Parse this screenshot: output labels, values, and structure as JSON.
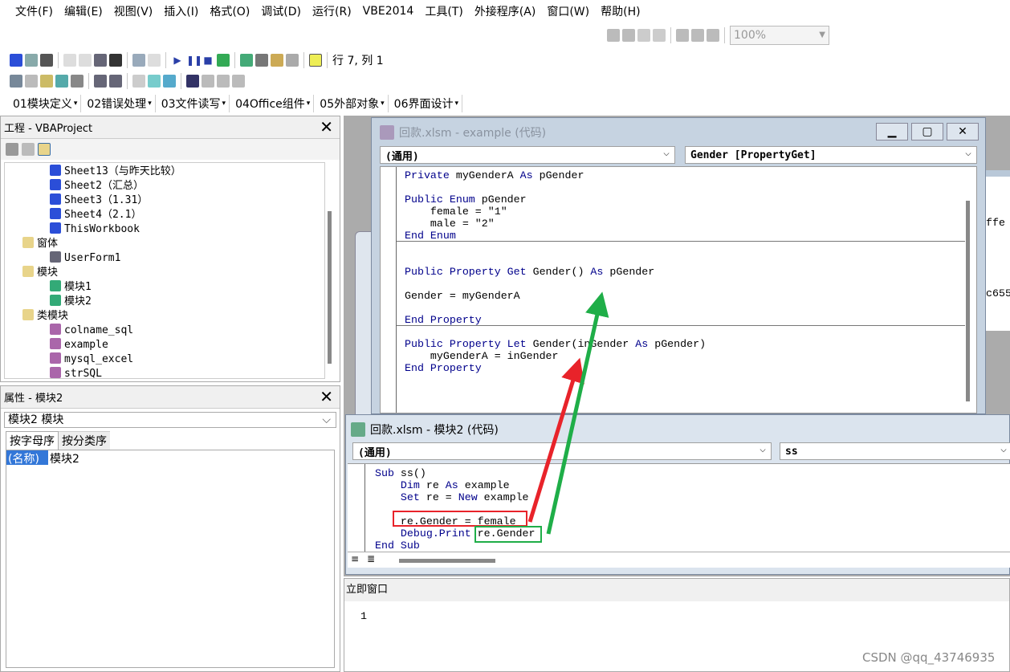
{
  "menu": [
    "文件(F)",
    "编辑(E)",
    "视图(V)",
    "插入(I)",
    "格式(O)",
    "调试(D)",
    "运行(R)",
    "VBE2014",
    "工具(T)",
    "外接程序(A)",
    "窗口(W)",
    "帮助(H)"
  ],
  "toolbar": {
    "zoom": "100%",
    "position": "行 7, 列 1",
    "addins": [
      "01模块定义",
      "02错误处理",
      "03文件读写",
      "04Office组件",
      "05外部对象",
      "06界面设计"
    ]
  },
  "project": {
    "title": "工程 - VBAProject",
    "items": [
      {
        "label": "Sheet13（与昨天比较）",
        "level": 2,
        "icon": "sheet-icon"
      },
      {
        "label": "Sheet2（汇总）",
        "level": 2,
        "icon": "sheet-icon"
      },
      {
        "label": "Sheet3（1.31）",
        "level": 2,
        "icon": "sheet-icon"
      },
      {
        "label": "Sheet4（2.1）",
        "level": 2,
        "icon": "sheet-icon"
      },
      {
        "label": "ThisWorkbook",
        "level": 2,
        "icon": "sheet-icon"
      },
      {
        "label": "窗体",
        "level": 1,
        "icon": "folder-icon"
      },
      {
        "label": "UserForm1",
        "level": 2,
        "icon": "form-icon"
      },
      {
        "label": "模块",
        "level": 1,
        "icon": "folder-icon"
      },
      {
        "label": "模块1",
        "level": 2,
        "icon": "module-icon"
      },
      {
        "label": "模块2",
        "level": 2,
        "icon": "module-icon"
      },
      {
        "label": "类模块",
        "level": 1,
        "icon": "folder-icon"
      },
      {
        "label": "colname_sql",
        "level": 2,
        "icon": "class-icon"
      },
      {
        "label": "example",
        "level": 2,
        "icon": "class-icon"
      },
      {
        "label": "mysql_excel",
        "level": 2,
        "icon": "class-icon"
      },
      {
        "label": "strSQL",
        "level": 2,
        "icon": "class-icon"
      }
    ]
  },
  "properties": {
    "title": "属性 - 模块2",
    "object": "模块2 模块",
    "tabs": [
      "按字母序",
      "按分类序"
    ],
    "row": {
      "name": "(名称)",
      "value": "模块2"
    }
  },
  "example_window": {
    "title": "回款.xlsm - example (代码)",
    "object": "(通用)",
    "procedure": "Gender [PropertyGet]",
    "lines": [
      [
        [
          "kw",
          "Private "
        ],
        [
          "",
          "myGenderA "
        ],
        [
          "kw",
          "As "
        ],
        [
          "",
          "pGender"
        ]
      ],
      [],
      [
        [
          "kw",
          "Public Enum "
        ],
        [
          "",
          "pGender"
        ]
      ],
      [
        [
          "",
          "    female = \"1\""
        ]
      ],
      [
        [
          "",
          "    male = \"2\""
        ]
      ],
      [
        [
          "kw",
          "End Enum"
        ]
      ],
      [],
      [],
      [
        [
          "kw",
          "Public Property Get "
        ],
        [
          "",
          "Gender() "
        ],
        [
          "kw",
          "As "
        ],
        [
          "",
          "pGender"
        ]
      ],
      [],
      [
        [
          "",
          "Gender = myGenderA"
        ]
      ],
      [],
      [
        [
          "kw",
          "End Property"
        ]
      ],
      [],
      [
        [
          "kw",
          "Public Property Let "
        ],
        [
          "",
          "Gender(inGender "
        ],
        [
          "kw",
          "As "
        ],
        [
          "",
          "pGender)"
        ]
      ],
      [
        [
          "",
          "    myGenderA = inGender"
        ]
      ],
      [
        [
          "kw",
          "End Property"
        ]
      ]
    ]
  },
  "module_window": {
    "title": "回款.xlsm - 模块2 (代码)",
    "object": "(通用)",
    "procedure": "ss",
    "lines": [
      [
        [
          "kw",
          "Sub "
        ],
        [
          "",
          "ss()"
        ]
      ],
      [
        [
          "kw",
          "    Dim "
        ],
        [
          "",
          "re "
        ],
        [
          "kw",
          "As "
        ],
        [
          "",
          "example"
        ]
      ],
      [
        [
          "kw",
          "    Set "
        ],
        [
          "",
          "re = "
        ],
        [
          "kw",
          "New "
        ],
        [
          "",
          "example"
        ]
      ],
      [],
      [
        [
          "",
          "    re.Gender = female"
        ]
      ],
      [
        [
          "kw",
          "    Debug.Print "
        ],
        [
          "",
          "re.Gender"
        ]
      ],
      [
        [
          "kw",
          "End Sub"
        ]
      ]
    ]
  },
  "immediate": {
    "title": "立即窗口",
    "output": "1"
  },
  "background_window": {
    "fragment1": "ffe",
    "fragment2": "c655"
  },
  "watermark": "CSDN @qq_43746935",
  "colors": {
    "keyword": "#00008b",
    "red_annotation": "#e8232a",
    "green_annotation": "#1fae48"
  }
}
